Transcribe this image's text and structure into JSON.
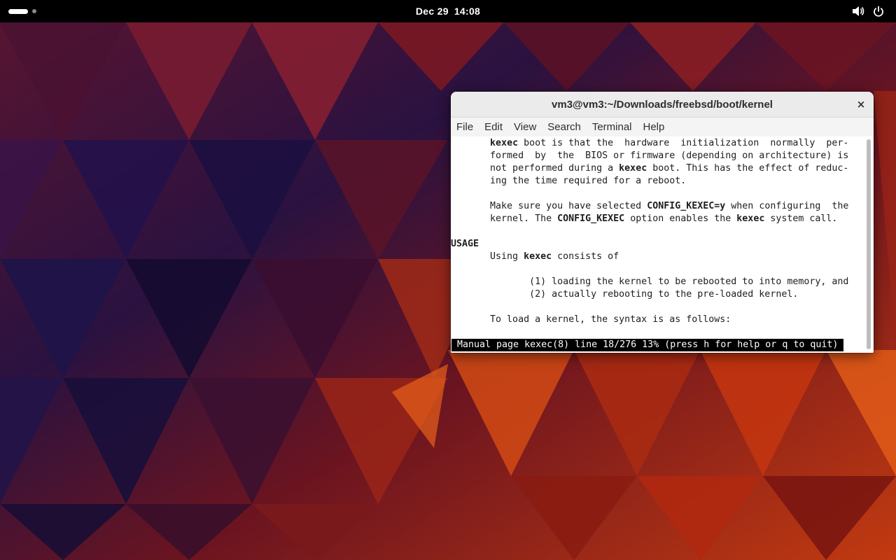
{
  "topbar": {
    "date": "Dec 29",
    "time": "14:08",
    "volume_icon": "speaker-icon",
    "power_icon": "power-icon"
  },
  "window": {
    "title": "vm3@vm3:~/Downloads/freebsd/boot/kernel",
    "close_label": "×",
    "menu": [
      "File",
      "Edit",
      "View",
      "Search",
      "Terminal",
      "Help"
    ]
  },
  "terminal": {
    "lines": [
      [
        {
          "t": "       "
        },
        {
          "t": "kexec",
          "b": true
        },
        {
          "t": " boot is that the  hardware  initialization  normally  per-"
        }
      ],
      [
        {
          "t": "       formed  by  the  BIOS or firmware (depending on architecture) is"
        }
      ],
      [
        {
          "t": "       not performed during a "
        },
        {
          "t": "kexec",
          "b": true
        },
        {
          "t": " boot. This has the effect of reduc-"
        }
      ],
      [
        {
          "t": "       ing the time required for a reboot."
        }
      ],
      [
        {
          "t": ""
        }
      ],
      [
        {
          "t": "       Make sure you have selected "
        },
        {
          "t": "CONFIG_KEXEC=y",
          "b": true
        },
        {
          "t": " when configuring  the"
        }
      ],
      [
        {
          "t": "       kernel. The "
        },
        {
          "t": "CONFIG_KEXEC",
          "b": true
        },
        {
          "t": " option enables the "
        },
        {
          "t": "kexec",
          "b": true
        },
        {
          "t": " system call."
        }
      ],
      [
        {
          "t": ""
        }
      ],
      [
        {
          "t": "USAGE",
          "b": true
        }
      ],
      [
        {
          "t": "       Using "
        },
        {
          "t": "kexec",
          "b": true
        },
        {
          "t": " consists of"
        }
      ],
      [
        {
          "t": ""
        }
      ],
      [
        {
          "t": "              (1) loading the kernel to be rebooted to into memory, and"
        }
      ],
      [
        {
          "t": "              (2) actually rebooting to the pre-loaded kernel."
        }
      ],
      [
        {
          "t": ""
        }
      ],
      [
        {
          "t": "       To load a kernel, the syntax is as follows:"
        }
      ],
      [
        {
          "t": ""
        }
      ]
    ],
    "status": "Manual page kexec(8) line 18/276 13% (press h for help or q to quit)"
  },
  "colors": {
    "topbar": "#000000",
    "window_header": "#ebebeb",
    "terminal_bg": "#ffffff",
    "terminal_fg": "#1e1e1e",
    "status_bg": "#000000",
    "status_fg": "#ffffff"
  }
}
